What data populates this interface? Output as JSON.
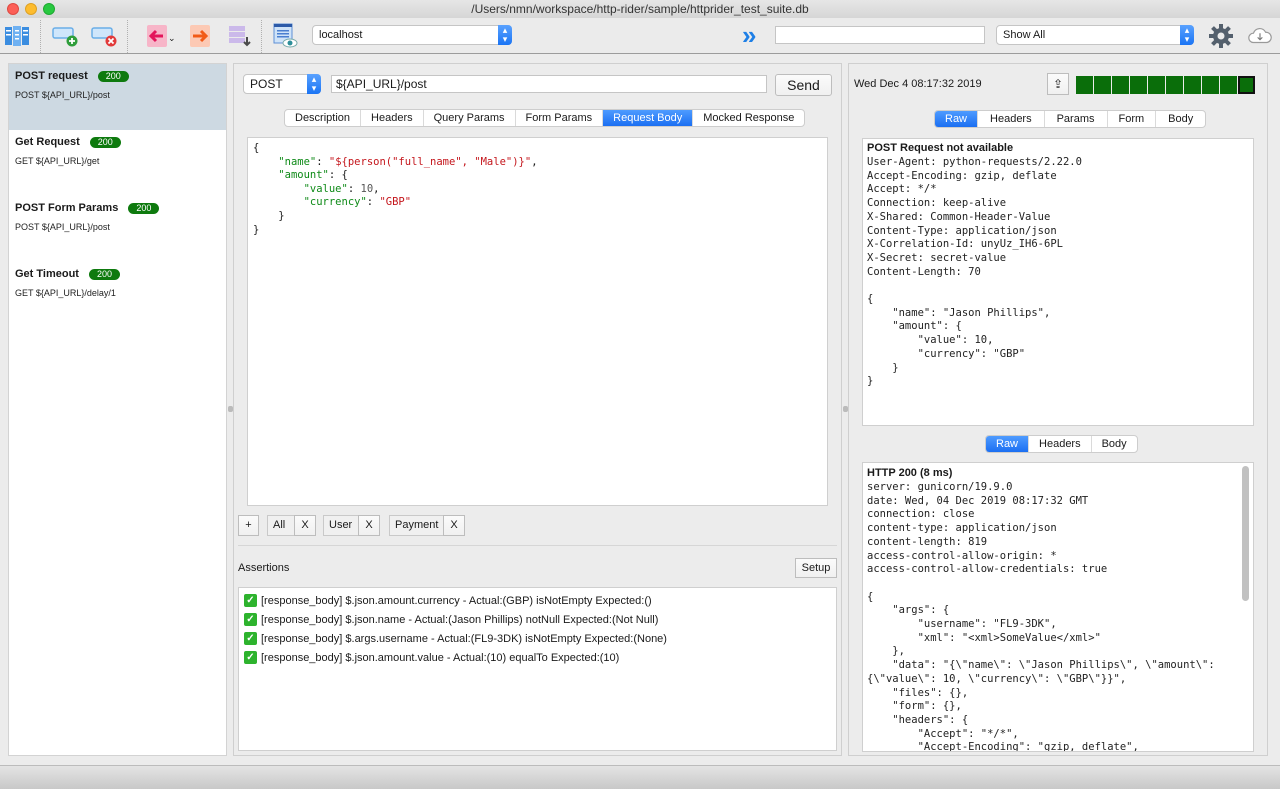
{
  "window": {
    "title": "/Users/nmn/workspace/http-rider/sample/httprider_test_suite.db"
  },
  "toolbar": {
    "environment": "localhost",
    "search_value": "",
    "filter": "Show All"
  },
  "requests": [
    {
      "title": "POST request",
      "status": "200",
      "subtitle": "POST ${API_URL}/post",
      "selected": true
    },
    {
      "title": "Get Request",
      "status": "200",
      "subtitle": "GET ${API_URL}/get",
      "selected": false
    },
    {
      "title": "POST Form Params",
      "status": "200",
      "subtitle": "POST ${API_URL}/post",
      "selected": false
    },
    {
      "title": "Get Timeout",
      "status": "200",
      "subtitle": "GET ${API_URL}/delay/1",
      "selected": false
    }
  ],
  "editor": {
    "method": "POST",
    "url": "${API_URL}/post",
    "send_label": "Send",
    "tabs": [
      "Description",
      "Headers",
      "Query Params",
      "Form Params",
      "Request Body",
      "Mocked Response"
    ],
    "active_tab": "Request Body",
    "body_lines": [
      "{",
      "    \"name\": \"${person(\"full_name\", \"Male\")}\",",
      "    \"amount\": {",
      "        \"value\": 10,",
      "        \"currency\": \"GBP\"",
      "    }",
      "}"
    ],
    "add_tag_label": "+",
    "tags": [
      "All",
      "User",
      "Payment"
    ],
    "tag_remove_label": "X",
    "assertions_label": "Assertions",
    "setup_label": "Setup",
    "assertions": [
      "[response_body] $.json.amount.currency - Actual:(GBP) isNotEmpty Expected:()",
      "[response_body] $.json.name - Actual:(Jason Phillips) notNull Expected:(Not Null)",
      "[response_body] $.args.username - Actual:(FL9-3DK) isNotEmpty Expected:(None)",
      "[response_body] $.json.amount.value - Actual:(10) equalTo Expected:(10)"
    ]
  },
  "exchange": {
    "timestamp": "Wed Dec  4 08:17:32 2019",
    "history_count": 10,
    "request_tabs": [
      "Raw",
      "Headers",
      "Params",
      "Form",
      "Body"
    ],
    "request_active_tab": "Raw",
    "request_title": "POST Request not available",
    "request_headers": [
      "User-Agent: python-requests/2.22.0",
      "Accept-Encoding: gzip, deflate",
      "Accept: */*",
      "Connection: keep-alive",
      "X-Shared: Common-Header-Value",
      "Content-Type: application/json",
      "X-Correlation-Id: unyUz_IH6-6PL",
      "X-Secret: secret-value",
      "Content-Length: 70",
      "",
      "{",
      "    \"name\": \"Jason Phillips\",",
      "    \"amount\": {",
      "        \"value\": 10,",
      "        \"currency\": \"GBP\"",
      "    }",
      "}"
    ],
    "response_tabs": [
      "Raw",
      "Headers",
      "Body"
    ],
    "response_active_tab": "Raw",
    "response_title": "HTTP 200 (8 ms)",
    "response_lines": [
      "server: gunicorn/19.9.0",
      "date: Wed, 04 Dec 2019 08:17:32 GMT",
      "connection: close",
      "content-type: application/json",
      "content-length: 819",
      "access-control-allow-origin: *",
      "access-control-allow-credentials: true",
      "",
      "{",
      "    \"args\": {",
      "        \"username\": \"FL9-3DK\",",
      "        \"xml\": \"<xml>SomeValue</xml>\"",
      "    },",
      "    \"data\": \"{\\\"name\\\": \\\"Jason Phillips\\\", \\\"amount\\\":",
      "{\\\"value\\\": 10, \\\"currency\\\": \\\"GBP\\\"}}\",",
      "    \"files\": {},",
      "    \"form\": {},",
      "    \"headers\": {",
      "        \"Accept\": \"*/*\",",
      "        \"Accept-Encoding\": \"gzip, deflate\","
    ]
  }
}
